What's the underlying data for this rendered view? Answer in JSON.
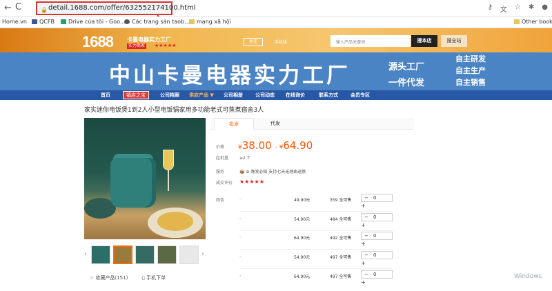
{
  "browser": {
    "back": "←",
    "forward": "→",
    "reload": "C",
    "url": "detail.1688.com/offer/632552174100.html",
    "lock": "🔒",
    "icons": [
      "⚷",
      "文",
      "☆",
      "✱",
      "●"
    ]
  },
  "bookmarks": [
    {
      "label": "Home.vn"
    },
    {
      "label": "QCFB"
    },
    {
      "label": "Drive của tôi - Goo..."
    },
    {
      "label": "Các trang sản taob..."
    },
    {
      "label": "mạng xã hội"
    },
    {
      "label": "Other bookm"
    }
  ],
  "store": {
    "logo": "1688",
    "name": "卡曼电器实力工厂",
    "tag": "实力商家",
    "stars": "★★★★★",
    "follow": "关注",
    "mobile": "手机版",
    "search_placeholder": "输入产品关键词",
    "search_store": "搜本店",
    "search_all": "搜全站"
  },
  "banner": {
    "title": "中山卡曼电器实力工厂",
    "mid": [
      "源头工厂",
      "一件代发"
    ],
    "right": [
      "自主研发",
      "自主生产",
      "自主销售"
    ]
  },
  "nav": {
    "items": [
      "首页",
      "公司档案",
      "供应产品 ▼",
      "公司相册",
      "公司动态",
      "在线询价",
      "联系方式",
      "会员专区"
    ],
    "hot": "镇店之宝"
  },
  "product": {
    "title": "家实迷你电饭煲1到2人小型电饭锅家用多功能老式可蒸煮宿舍3人",
    "tabs": [
      "批发",
      "代发"
    ],
    "price_label": "价格",
    "price_low": "38.00",
    "price_high": "64.90",
    "currency": "¥",
    "min_label": "起批量",
    "min_value": "≥2 个",
    "service_label": "服务",
    "service_value": "📦 ⊕ 晚发必赔 支持七天无理由退换",
    "rating_label": "成交评价",
    "rating": "★★★★★",
    "color_label": "颜色",
    "variants": [
      {
        "name": "-",
        "price": "49.90元",
        "stock": "359 全可售",
        "qty": "0"
      },
      {
        "name": "-",
        "price": "54.90元",
        "stock": "484 全可售",
        "qty": "0"
      },
      {
        "name": "-",
        "price": "64.90元",
        "stock": "492 全可售",
        "qty": "0"
      },
      {
        "name": "-",
        "price": "54.90元",
        "stock": "497 全可售",
        "qty": "0"
      },
      {
        "name": "-",
        "price": "64.90元",
        "stock": "497 全可售",
        "qty": "0"
      }
    ],
    "favorite": "☆ 收藏产品(151)",
    "mobile_order": "▯ 手机下单"
  },
  "watermark": "Windows"
}
